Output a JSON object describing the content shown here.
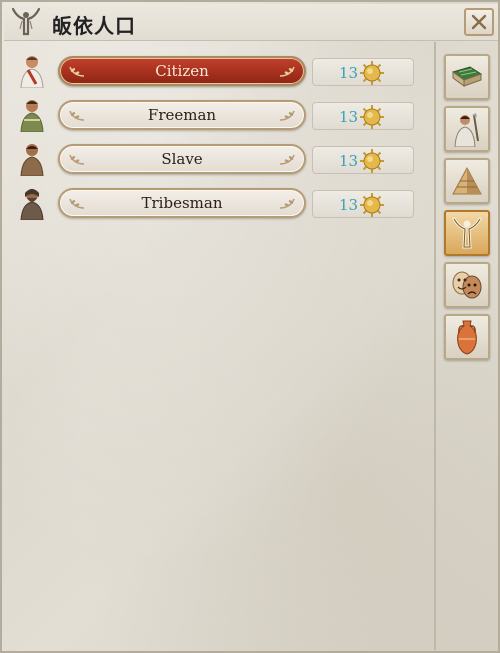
{
  "window": {
    "title": "皈依人口",
    "title_icon": "figure-arms-raised-icon",
    "close_icon": "close-x-icon"
  },
  "population": {
    "selected": "Citizen",
    "rows": [
      {
        "label": "Citizen",
        "count": "13",
        "portrait_icon": "citizen-portrait-icon",
        "resource_icon": "sun-coin-icon",
        "selected": true
      },
      {
        "label": "Freeman",
        "count": "13",
        "portrait_icon": "freeman-portrait-icon",
        "resource_icon": "sun-coin-icon",
        "selected": false
      },
      {
        "label": "Slave",
        "count": "13",
        "portrait_icon": "slave-portrait-icon",
        "resource_icon": "sun-coin-icon",
        "selected": false
      },
      {
        "label": "Tribesman",
        "count": "13",
        "portrait_icon": "tribesman-portrait-icon",
        "resource_icon": "sun-coin-icon",
        "selected": false
      }
    ]
  },
  "sidebar": {
    "active": "religion",
    "items": [
      {
        "id": "territory",
        "icon": "banknote-map-icon"
      },
      {
        "id": "military",
        "icon": "soldier-icon"
      },
      {
        "id": "culture",
        "icon": "pyramid-icon"
      },
      {
        "id": "religion",
        "icon": "figure-arms-raised-icon"
      },
      {
        "id": "theater",
        "icon": "theater-masks-icon"
      },
      {
        "id": "trade",
        "icon": "amphora-icon"
      }
    ]
  },
  "colors": {
    "selected_button": "#a8301d",
    "count_text": "#39a0b8",
    "gold_border": "#b59c76",
    "parchment": "#e2ded4"
  }
}
